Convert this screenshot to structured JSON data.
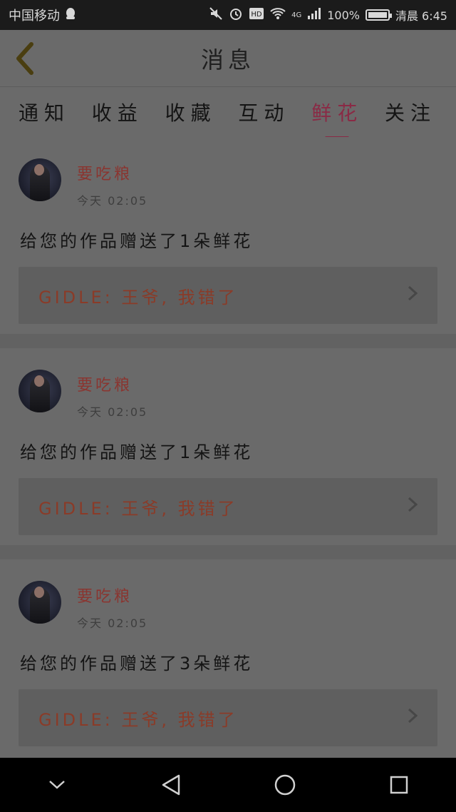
{
  "status_bar": {
    "carrier": "中国移动",
    "network": "4G",
    "battery_text": "100%",
    "battery_level": 1.0,
    "time": "清晨 6:45"
  },
  "header": {
    "title": "消息"
  },
  "tabs": [
    {
      "label": "通知",
      "active": false
    },
    {
      "label": "收益",
      "active": false
    },
    {
      "label": "收藏",
      "active": false
    },
    {
      "label": "互动",
      "active": false
    },
    {
      "label": "鲜花",
      "active": true
    },
    {
      "label": "关注",
      "active": false
    }
  ],
  "messages": [
    {
      "username": "要吃粮",
      "timestamp": "今天  02:05",
      "text": "给您的作品赠送了1朵鲜花",
      "quote": "GIDLE: 王爷, 我错了"
    },
    {
      "username": "要吃粮",
      "timestamp": "今天  02:05",
      "text": "给您的作品赠送了1朵鲜花",
      "quote": "GIDLE: 王爷, 我错了"
    },
    {
      "username": "要吃粮",
      "timestamp": "今天  02:05",
      "text": "给您的作品赠送了3朵鲜花",
      "quote": "GIDLE: 王爷, 我错了"
    }
  ],
  "colors": {
    "accent": "#8a2a45",
    "username": "#8a3530",
    "quote": "#8a3b28"
  },
  "icons": {
    "back": "chevron-left-icon",
    "quote_arrow": "chevron-right-icon"
  }
}
